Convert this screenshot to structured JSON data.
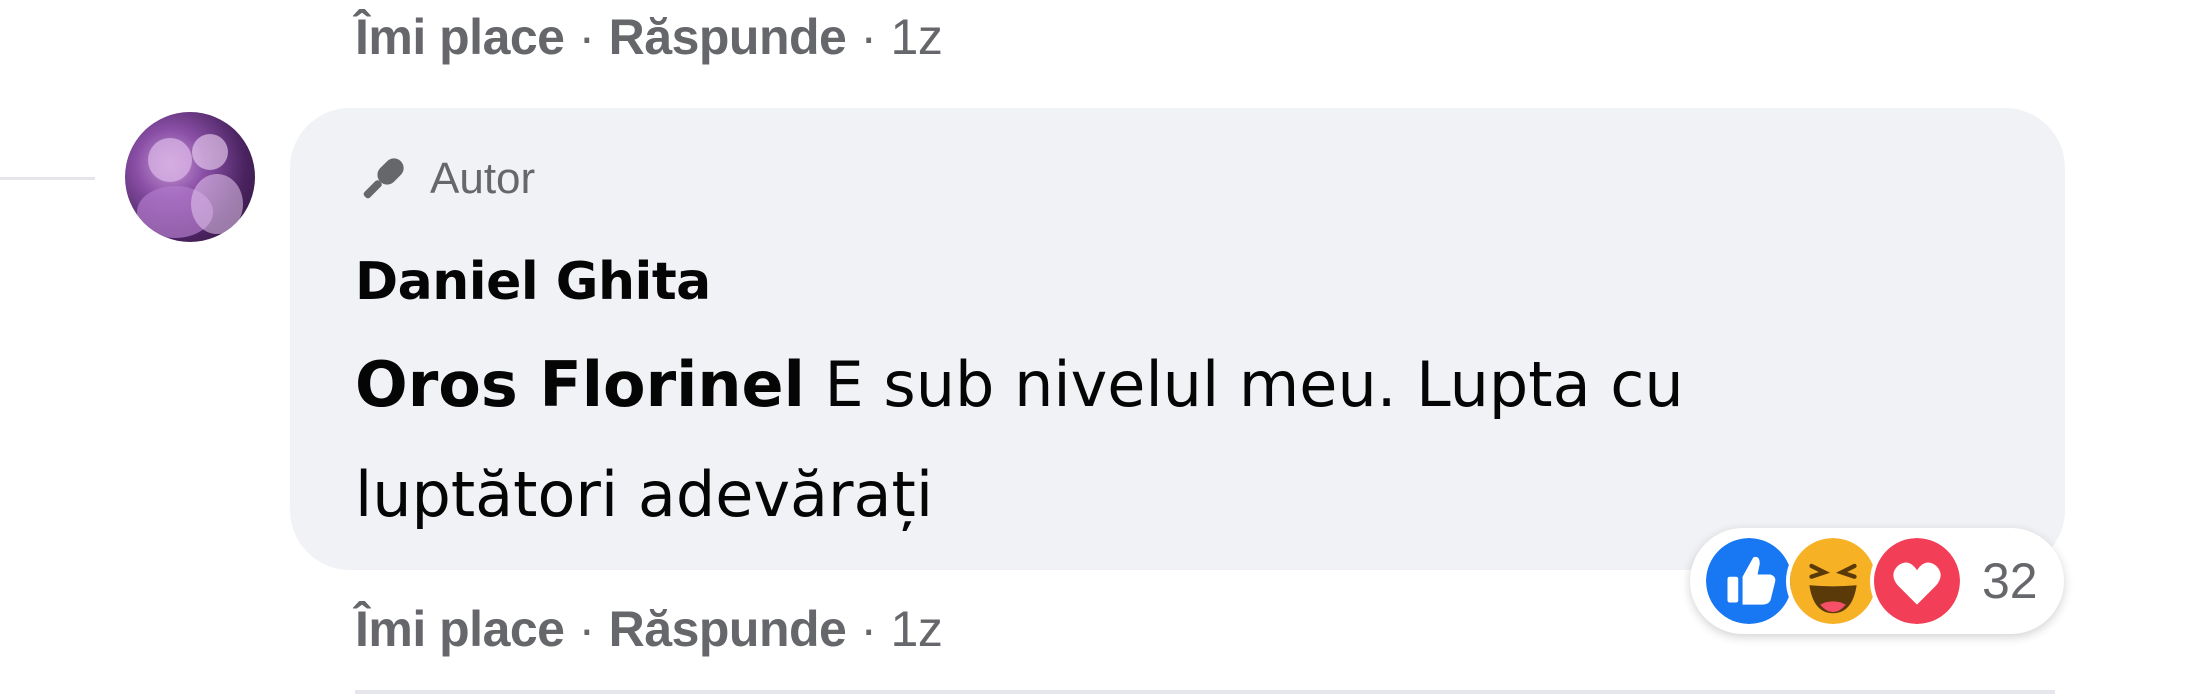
{
  "prev_actions": {
    "like": "Îmi place",
    "sep1": "·",
    "reply": "Răspunde",
    "sep2": "·",
    "time": "1z"
  },
  "comment": {
    "badge_label": "Autor",
    "badge_icon": "microphone-icon",
    "author": "Daniel Ghita",
    "mention": "Oros Florinel",
    "text": " E sub nivelul meu. Lupta cu luptători adevărați"
  },
  "reactions": {
    "icons": [
      "like-icon",
      "haha-icon",
      "love-icon"
    ],
    "count": "32",
    "colors": {
      "like": "#1877f2",
      "haha": "#f7b125",
      "love": "#f33e58"
    }
  },
  "actions": {
    "like": "Îmi place",
    "sep1": "·",
    "reply": "Răspunde",
    "sep2": "·",
    "time": "1z"
  }
}
